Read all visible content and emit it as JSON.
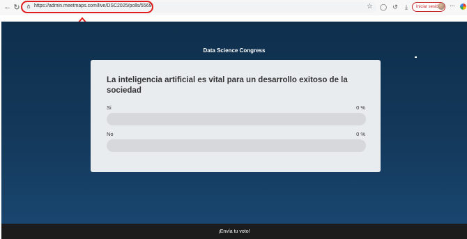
{
  "browser": {
    "url": "https://admin.meetmaps.com/live/DSC2025/polls/5569",
    "signin_label": "Iniciar sesión"
  },
  "event": {
    "title": "Data Science Congress"
  },
  "poll": {
    "question": "La inteligencia artificial es vital para un desarrollo exitoso de la sociedad",
    "options": [
      {
        "label": "Si",
        "percent_label": "0 %",
        "percent": 0
      },
      {
        "label": "No",
        "percent_label": "0 %",
        "percent": 0
      }
    ]
  },
  "footer": {
    "cta": "¡Envía tu voto!"
  },
  "colors": {
    "annotation": "#e11d1d",
    "background_top": "#0f2f4d",
    "background_bottom": "#19466f",
    "card": "#e9ecef",
    "footer": "#1c1c1c"
  },
  "icons": [
    "back-icon",
    "reload-icon",
    "lock-icon",
    "star-icon",
    "extensions-icon",
    "history-icon",
    "downloads-icon",
    "more-icon",
    "profile-icon",
    "annotation-arrow-icon"
  ]
}
